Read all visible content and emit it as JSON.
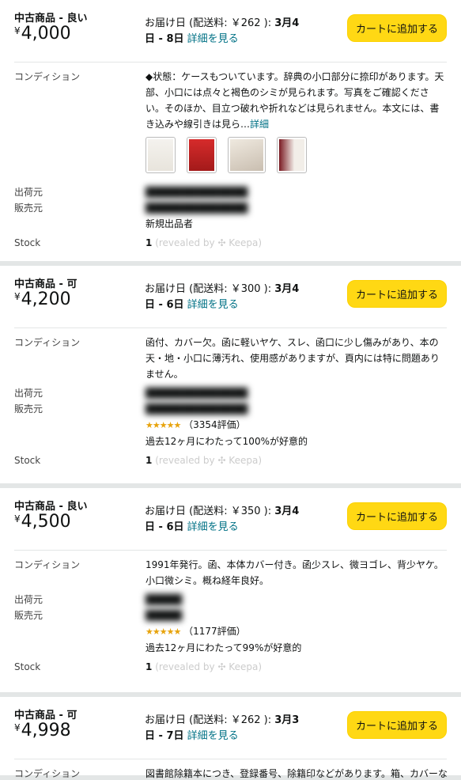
{
  "offers": [
    {
      "condition": "中古商品 - 良い",
      "price_symbol": "¥",
      "price": "4,000",
      "delivery_prefix": "お届け日 (配送料: ￥262 ): ",
      "delivery_date_a": "3月4",
      "delivery_date_b": "日 - 8日",
      "detail_link": "詳細を見る",
      "cart_button": "カートに追加する",
      "condition_label": "コンディション",
      "condition_text": "◆状態：ケースもついています。辞典の小口部分に捺印があります。天部、小口には点々と褐色のシミが見られます。写真をご確認ください。そのほか、目立つ破れや折れなどは見られません。本文には、書き込みや線引きは見ら…",
      "condition_more": "詳細",
      "ships_from_label": "出荷元",
      "sold_by_label": "販売元",
      "seller_note": "新規出品者",
      "stock_label": "Stock",
      "stock_value": "1",
      "stock_note": "(revealed by ✣ Keepa)"
    },
    {
      "condition": "中古商品 - 可",
      "price_symbol": "¥",
      "price": "4,200",
      "delivery_prefix": "お届け日 (配送料: ￥300 ): ",
      "delivery_date_a": "3月4",
      "delivery_date_b": "日 - 6日",
      "detail_link": "詳細を見る",
      "cart_button": "カートに追加する",
      "condition_label": "コンディション",
      "condition_text": "函付、カバー欠。函に軽いヤケ、スレ、函口に少し傷みがあり、本の天・地・小口に薄汚れ、使用感がありますが、頁内には特に問題ありません。",
      "ships_from_label": "出荷元",
      "sold_by_label": "販売元",
      "rating_stars": "★★★★★",
      "rating_count": "（3354評価）",
      "rating_text": "過去12ヶ月にわたって100%が好意的",
      "stock_label": "Stock",
      "stock_value": "1",
      "stock_note": "(revealed by ✣ Keepa)"
    },
    {
      "condition": "中古商品 - 良い",
      "price_symbol": "¥",
      "price": "4,500",
      "delivery_prefix": "お届け日 (配送料: ￥350 ): ",
      "delivery_date_a": "3月4",
      "delivery_date_b": "日 - 6日",
      "detail_link": "詳細を見る",
      "cart_button": "カートに追加する",
      "condition_label": "コンディション",
      "condition_text": "1991年発行。函、本体カバー付き。函少スレ、微ヨゴレ、背少ヤケ。小口微シミ。概ね経年良好。",
      "ships_from_label": "出荷元",
      "sold_by_label": "販売元",
      "rating_stars": "★★★★★",
      "rating_count": "（1177評価）",
      "rating_text": "過去12ヶ月にわたって99%が好意的",
      "stock_label": "Stock",
      "stock_value": "1",
      "stock_note": "(revealed by ✣ Keepa)"
    },
    {
      "condition": "中古商品 - 可",
      "price_symbol": "¥",
      "price": "4,998",
      "delivery_prefix": "お届け日 (配送料: ￥262 ): ",
      "delivery_date_a": "3月3",
      "delivery_date_b": "日 - 7日",
      "detail_link": "詳細を見る",
      "cart_button": "カートに追加する",
      "condition_label": "コンディション",
      "condition_text": "図書館除籍本につき、登録番号、除籍印などがあります。箱、カバーな"
    }
  ]
}
